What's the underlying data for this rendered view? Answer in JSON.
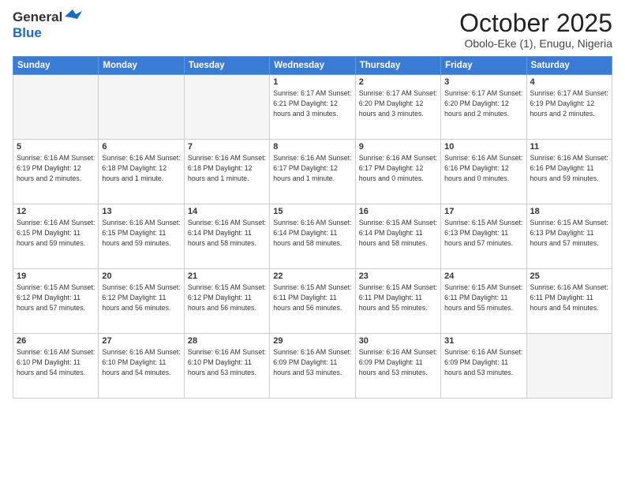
{
  "header": {
    "logo_general": "General",
    "logo_blue": "Blue",
    "month_title": "October 2025",
    "location": "Obolo-Eke (1), Enugu, Nigeria"
  },
  "weekdays": [
    "Sunday",
    "Monday",
    "Tuesday",
    "Wednesday",
    "Thursday",
    "Friday",
    "Saturday"
  ],
  "weeks": [
    [
      {
        "day": "",
        "info": ""
      },
      {
        "day": "",
        "info": ""
      },
      {
        "day": "",
        "info": ""
      },
      {
        "day": "1",
        "info": "Sunrise: 6:17 AM\nSunset: 6:21 PM\nDaylight: 12 hours and 3 minutes."
      },
      {
        "day": "2",
        "info": "Sunrise: 6:17 AM\nSunset: 6:20 PM\nDaylight: 12 hours and 3 minutes."
      },
      {
        "day": "3",
        "info": "Sunrise: 6:17 AM\nSunset: 6:20 PM\nDaylight: 12 hours and 2 minutes."
      },
      {
        "day": "4",
        "info": "Sunrise: 6:17 AM\nSunset: 6:19 PM\nDaylight: 12 hours and 2 minutes."
      }
    ],
    [
      {
        "day": "5",
        "info": "Sunrise: 6:16 AM\nSunset: 6:19 PM\nDaylight: 12 hours and 2 minutes."
      },
      {
        "day": "6",
        "info": "Sunrise: 6:16 AM\nSunset: 6:18 PM\nDaylight: 12 hours and 1 minute."
      },
      {
        "day": "7",
        "info": "Sunrise: 6:16 AM\nSunset: 6:18 PM\nDaylight: 12 hours and 1 minute."
      },
      {
        "day": "8",
        "info": "Sunrise: 6:16 AM\nSunset: 6:17 PM\nDaylight: 12 hours and 1 minute."
      },
      {
        "day": "9",
        "info": "Sunrise: 6:16 AM\nSunset: 6:17 PM\nDaylight: 12 hours and 0 minutes."
      },
      {
        "day": "10",
        "info": "Sunrise: 6:16 AM\nSunset: 6:16 PM\nDaylight: 12 hours and 0 minutes."
      },
      {
        "day": "11",
        "info": "Sunrise: 6:16 AM\nSunset: 6:16 PM\nDaylight: 11 hours and 59 minutes."
      }
    ],
    [
      {
        "day": "12",
        "info": "Sunrise: 6:16 AM\nSunset: 6:15 PM\nDaylight: 11 hours and 59 minutes."
      },
      {
        "day": "13",
        "info": "Sunrise: 6:16 AM\nSunset: 6:15 PM\nDaylight: 11 hours and 59 minutes."
      },
      {
        "day": "14",
        "info": "Sunrise: 6:16 AM\nSunset: 6:14 PM\nDaylight: 11 hours and 58 minutes."
      },
      {
        "day": "15",
        "info": "Sunrise: 6:16 AM\nSunset: 6:14 PM\nDaylight: 11 hours and 58 minutes."
      },
      {
        "day": "16",
        "info": "Sunrise: 6:15 AM\nSunset: 6:14 PM\nDaylight: 11 hours and 58 minutes."
      },
      {
        "day": "17",
        "info": "Sunrise: 6:15 AM\nSunset: 6:13 PM\nDaylight: 11 hours and 57 minutes."
      },
      {
        "day": "18",
        "info": "Sunrise: 6:15 AM\nSunset: 6:13 PM\nDaylight: 11 hours and 57 minutes."
      }
    ],
    [
      {
        "day": "19",
        "info": "Sunrise: 6:15 AM\nSunset: 6:12 PM\nDaylight: 11 hours and 57 minutes."
      },
      {
        "day": "20",
        "info": "Sunrise: 6:15 AM\nSunset: 6:12 PM\nDaylight: 11 hours and 56 minutes."
      },
      {
        "day": "21",
        "info": "Sunrise: 6:15 AM\nSunset: 6:12 PM\nDaylight: 11 hours and 56 minutes."
      },
      {
        "day": "22",
        "info": "Sunrise: 6:15 AM\nSunset: 6:11 PM\nDaylight: 11 hours and 56 minutes."
      },
      {
        "day": "23",
        "info": "Sunrise: 6:15 AM\nSunset: 6:11 PM\nDaylight: 11 hours and 55 minutes."
      },
      {
        "day": "24",
        "info": "Sunrise: 6:15 AM\nSunset: 6:11 PM\nDaylight: 11 hours and 55 minutes."
      },
      {
        "day": "25",
        "info": "Sunrise: 6:16 AM\nSunset: 6:11 PM\nDaylight: 11 hours and 54 minutes."
      }
    ],
    [
      {
        "day": "26",
        "info": "Sunrise: 6:16 AM\nSunset: 6:10 PM\nDaylight: 11 hours and 54 minutes."
      },
      {
        "day": "27",
        "info": "Sunrise: 6:16 AM\nSunset: 6:10 PM\nDaylight: 11 hours and 54 minutes."
      },
      {
        "day": "28",
        "info": "Sunrise: 6:16 AM\nSunset: 6:10 PM\nDaylight: 11 hours and 53 minutes."
      },
      {
        "day": "29",
        "info": "Sunrise: 6:16 AM\nSunset: 6:09 PM\nDaylight: 11 hours and 53 minutes."
      },
      {
        "day": "30",
        "info": "Sunrise: 6:16 AM\nSunset: 6:09 PM\nDaylight: 11 hours and 53 minutes."
      },
      {
        "day": "31",
        "info": "Sunrise: 6:16 AM\nSunset: 6:09 PM\nDaylight: 11 hours and 53 minutes."
      },
      {
        "day": "",
        "info": ""
      }
    ]
  ]
}
